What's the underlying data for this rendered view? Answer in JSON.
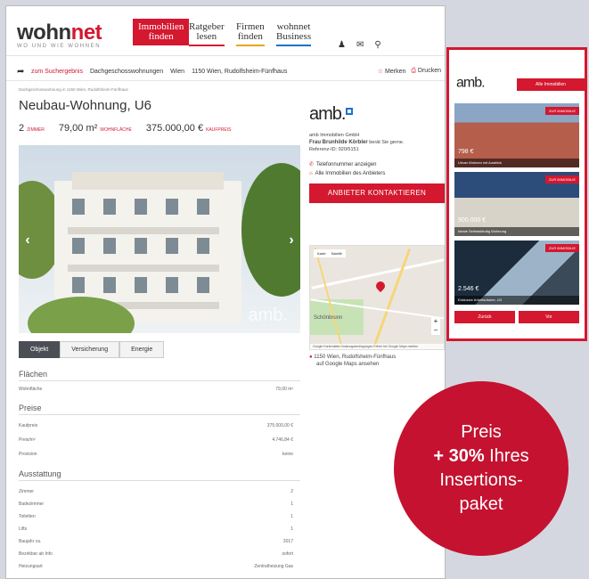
{
  "header": {
    "logo_main": "wohn",
    "logo_accent": "net",
    "logo_tagline": "WO UND WIE WOHNEN",
    "nav": [
      {
        "line1": "Immobilien",
        "line2": "finden",
        "active": true
      },
      {
        "line1": "Ratgeber",
        "line2": "lesen",
        "color": "#d3182f"
      },
      {
        "line1": "Firmen",
        "line2": "finden",
        "color": "#e8a51c"
      },
      {
        "line1": "wohnnet",
        "line2": "Business",
        "color": "#1a73c8"
      }
    ],
    "tools": [
      "♟",
      "✉",
      "⚲"
    ]
  },
  "breadcrumb": {
    "back": "zum Suchergebnis",
    "items": [
      "Dachgeschosswohnungen",
      "Wien",
      "1150 Wien, Rudolfsheim-Fünfhaus"
    ],
    "merken": "Merken",
    "drucken": "Drucken"
  },
  "listing": {
    "path": "Dachgeschosswohnung in 1150 Wien, Rudolfsheim-Fünfhaus",
    "title": "Neubau-Wohnung, U6",
    "rooms": "2",
    "rooms_label": "Zimmer",
    "area": "79,00 m²",
    "area_label": "Wohnfläche",
    "price": "375.000,00 €",
    "price_label": "Kaufpreis",
    "watermark": "amb."
  },
  "tabs": [
    "Objekt",
    "Versicherung",
    "Energie"
  ],
  "sections": {
    "flaechen": {
      "title": "Flächen",
      "rows": [
        {
          "k": "Wohnfläche",
          "v": "79,00 m²"
        }
      ]
    },
    "preise": {
      "title": "Preise",
      "rows": [
        {
          "k": "Kaufpreis",
          "v": "375.000,00 €"
        },
        {
          "k": "Preis/m²",
          "v": "4.746,84 €"
        },
        {
          "k": "Provision",
          "v": "keine"
        }
      ]
    },
    "ausstattung": {
      "title": "Ausstattung",
      "rows": [
        {
          "k": "Zimmer",
          "v": "2"
        },
        {
          "k": "Badezimmer",
          "v": "1"
        },
        {
          "k": "Toiletten",
          "v": "1"
        },
        {
          "k": "Lifts",
          "v": "1"
        },
        {
          "k": "Baujahr ca.",
          "v": "2017"
        },
        {
          "k": "Bezirkbar ab Info",
          "v": "sofort"
        },
        {
          "k": "Heizungsart",
          "v": "Zentralheizung Gas"
        }
      ]
    }
  },
  "agent": {
    "logo": "amb.",
    "company": "amb Immobilien GmbH",
    "person": "Frau Brunhilde Körbler",
    "person_suffix": " berät Sie gerne.",
    "ref": "Referenz-ID: 920/5151",
    "phone_link": "Telefonnummer anzeigen",
    "all_link": "Alle Immobilien des Anbieters",
    "cta": "ANBIETER KONTAKTIEREN"
  },
  "map": {
    "type_karte": "Karte",
    "type_sat": "Satellit",
    "label": "Schönbrunn",
    "footer": "Google   Kartendaten   Nutzungsbedingungen   Fehler bei Google Maps melden",
    "address": "1150 Wien, Rudolfsheim-Fünfhaus",
    "map_link": "auf Google Maps ansehen"
  },
  "ad": {
    "logo": "amb.",
    "button": "Alle Immobilien",
    "tiles": [
      {
        "badge": "ZUR IMMOBILIE",
        "price": "798 €",
        "caption": "Urban Wohnen mit Ausblick"
      },
      {
        "badge": "ZUR IMMOBILIE",
        "price": "900.000 €",
        "caption": "Ideale Selbstständig Wohnung"
      },
      {
        "badge": "ZUR IMMOBILIE",
        "price": "2.546 €",
        "caption": "Exklusive Arbeitsräume, U3"
      }
    ],
    "prev": "Zurück",
    "next": "Vor"
  },
  "promo": {
    "line1": "Preis",
    "line2_bold": "+ 30%",
    "line2_rest": " Ihres",
    "line3": "Insertions-",
    "line4": "paket"
  },
  "colors": {
    "brand": "#d3182f",
    "promo": "#c41230",
    "accent_blue": "#1a73c8"
  }
}
